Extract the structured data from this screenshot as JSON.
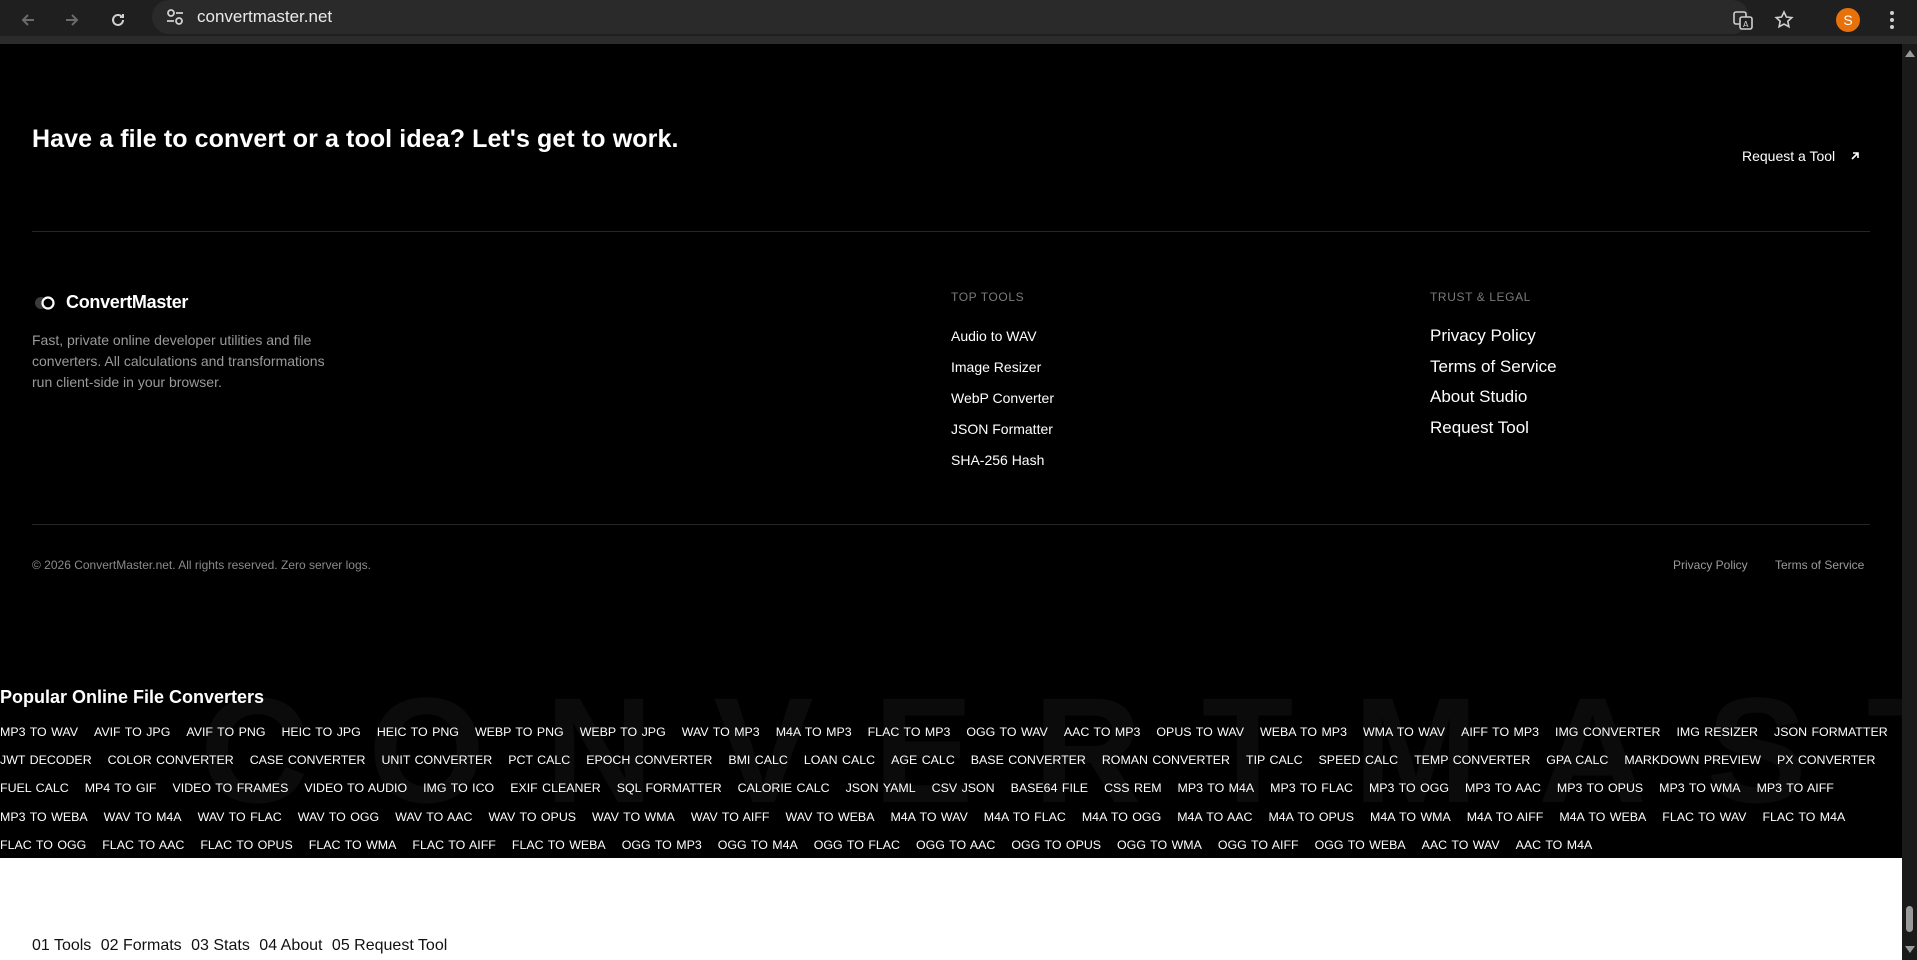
{
  "browser": {
    "url": "convertmaster.net",
    "profile_initial": "S"
  },
  "cta": {
    "heading": "Have a file to convert or a tool idea? Let's get to work.",
    "link_label": "Request a Tool"
  },
  "brand": {
    "name": "ConvertMaster",
    "description": "Fast, private online developer utilities and file converters. All calculations and transformations run client-side in your browser."
  },
  "top_tools": {
    "heading": "TOP TOOLS",
    "items": [
      "Audio to WAV",
      "Image Resizer",
      "WebP Converter",
      "JSON Formatter",
      "SHA-256 Hash"
    ]
  },
  "legal": {
    "heading": "TRUST & LEGAL",
    "items": [
      "Privacy Policy",
      "Terms of Service",
      "About Studio",
      "Request Tool"
    ]
  },
  "footer": {
    "copyright": "© 2026 ConvertMaster.net. All rights reserved. Zero server logs.",
    "privacy": "Privacy Policy",
    "terms": "Terms of Service"
  },
  "popular": {
    "title": "Popular Online File Converters",
    "watermark": "CONVERTMASTER",
    "rows": [
      [
        "MP3 TO WAV",
        "AVIF TO JPG",
        "AVIF TO PNG",
        "HEIC TO JPG",
        "HEIC TO PNG",
        "WEBP TO PNG",
        "WEBP TO JPG",
        "WAV TO MP3",
        "M4A TO MP3",
        "FLAC TO MP3",
        "OGG TO WAV",
        "AAC TO MP3",
        "OPUS TO WAV",
        "WEBA TO MP3",
        "WMA TO WAV",
        "AIFF TO MP3",
        "IMG CONVERTER",
        "IMG RESIZER",
        "JSON FORMATTER"
      ],
      [
        "JWT DECODER",
        "COLOR CONVERTER",
        "CASE CONVERTER",
        "UNIT CONVERTER",
        "PCT CALC",
        "EPOCH CONVERTER",
        "BMI CALC",
        "LOAN CALC",
        "AGE CALC",
        "BASE CONVERTER",
        "ROMAN CONVERTER",
        "TIP CALC",
        "SPEED CALC",
        "TEMP CONVERTER",
        "GPA CALC",
        "MARKDOWN PREVIEW",
        "PX CONVERTER"
      ],
      [
        "FUEL CALC",
        "MP4 TO GIF",
        "VIDEO TO FRAMES",
        "VIDEO TO AUDIO",
        "IMG TO ICO",
        "EXIF CLEANER",
        "SQL FORMATTER",
        "CALORIE CALC",
        "JSON YAML",
        "CSV JSON",
        "BASE64 FILE",
        "CSS REM",
        "MP3 TO M4A",
        "MP3 TO FLAC",
        "MP3 TO OGG",
        "MP3 TO AAC",
        "MP3 TO OPUS",
        "MP3 TO WMA",
        "MP3 TO AIFF"
      ],
      [
        "MP3 TO WEBA",
        "WAV TO M4A",
        "WAV TO FLAC",
        "WAV TO OGG",
        "WAV TO AAC",
        "WAV TO OPUS",
        "WAV TO WMA",
        "WAV TO AIFF",
        "WAV TO WEBA",
        "M4A TO WAV",
        "M4A TO FLAC",
        "M4A TO OGG",
        "M4A TO AAC",
        "M4A TO OPUS",
        "M4A TO WMA",
        "M4A TO AIFF",
        "M4A TO WEBA",
        "FLAC TO WAV",
        "FLAC TO M4A"
      ],
      [
        "FLAC TO OGG",
        "FLAC TO AAC",
        "FLAC TO OPUS",
        "FLAC TO WMA",
        "FLAC TO AIFF",
        "FLAC TO WEBA",
        "OGG TO MP3",
        "OGG TO M4A",
        "OGG TO FLAC",
        "OGG TO AAC",
        "OGG TO OPUS",
        "OGG TO WMA",
        "OGG TO AIFF",
        "OGG TO WEBA",
        "AAC TO WAV",
        "AAC TO M4A"
      ]
    ]
  },
  "bottom_nav": {
    "items": [
      "01 Tools",
      "02 Formats",
      "03 Stats",
      "04 About",
      "05 Request Tool"
    ]
  }
}
